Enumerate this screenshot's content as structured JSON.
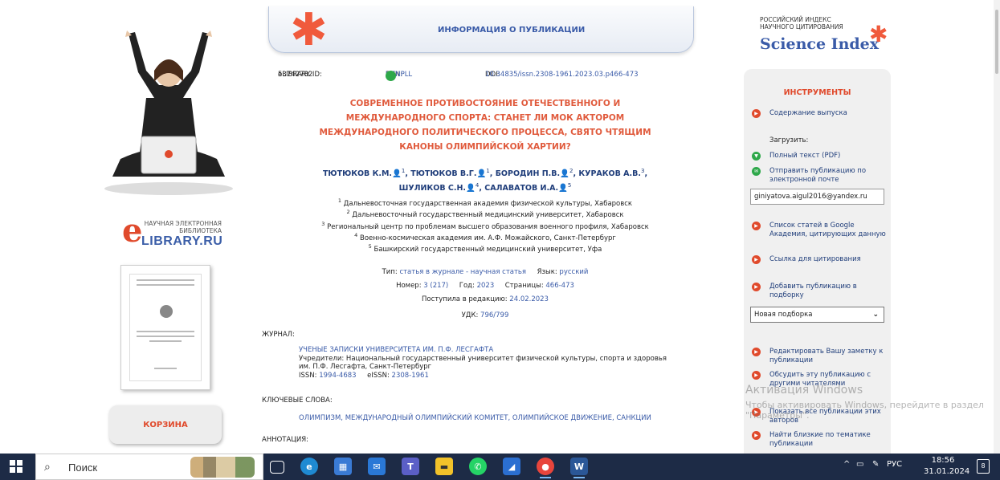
{
  "header": {
    "title": "ИНФОРМАЦИЯ О ПУБЛИКАЦИИ"
  },
  "science_index": {
    "line1": "РОССИЙСКИЙ ИНДЕКС",
    "line2": "НАУЧНОГО ЦИТИРОВАНИЯ",
    "name": "Science Index"
  },
  "elibrary": {
    "line1": "НАУЧНАЯ ЭЛЕКТРОННАЯ",
    "line2": "БИБЛИОТЕКА",
    "name": "LIBRARY.RU"
  },
  "ids": {
    "elibrary_label": "eLIBRARY ID:",
    "elibrary_id": "53742782",
    "edn_label": "EDN:",
    "edn": "HZNPLL",
    "doi_label": "DOI:",
    "doi": "10.34835/issn.2308-1961.2023.03.p466-473"
  },
  "article": {
    "title_lines": [
      "СОВРЕМЕННОЕ ПРОТИВОСТОЯНИЕ ОТЕЧЕСТВЕННОГО И",
      "МЕЖДУНАРОДНОГО СПОРТА: СТАНЕТ ЛИ МОК АКТОРОМ",
      "МЕЖДУНАРОДНОГО ПОЛИТИЧЕСКОГО ПРОЦЕССА, СВЯТО ЧТЯЩИМ",
      "КАНОНЫ ОЛИМПИЙСКОЙ ХАРТИИ?"
    ],
    "authors": [
      {
        "name": "ТЮТЮКОВ К.М.",
        "sup": "1"
      },
      {
        "name": "ТЮТЮКОВ В.Г.",
        "sup": "1"
      },
      {
        "name": "БОРОДИН П.В.",
        "sup": "2"
      },
      {
        "name": "КУРАКОВ А.В.",
        "sup": "3"
      },
      {
        "name": "ШУЛИКОВ С.Н.",
        "sup": "4"
      },
      {
        "name": "САЛАВАТОВ И.А.",
        "sup": "5"
      }
    ],
    "affiliations": [
      {
        "n": "1",
        "text": "Дальневосточная государственная академия физической культуры, Хабаровск"
      },
      {
        "n": "2",
        "text": "Дальневосточный государственный медицинский университет, Хабаровск"
      },
      {
        "n": "3",
        "text": "Региональный центр по проблемам высшего образования военного профиля, Хабаровск"
      },
      {
        "n": "4",
        "text": "Военно-космическая академия им. А.Ф. Можайского, Санкт-Петербург"
      },
      {
        "n": "5",
        "text": "Башкирский государственный медицинский университет, Уфа"
      }
    ],
    "type_label": "Тип:",
    "type": "статья в журнале - научная статья",
    "lang_label": "Язык:",
    "lang": "русский",
    "number_label": "Номер:",
    "number": "3 (217)",
    "year_label": "Год:",
    "year": "2023",
    "pages_label": "Страницы:",
    "pages": "466-473",
    "received_label": "Поступила в редакцию:",
    "received": "24.02.2023",
    "udk_label": "УДК:",
    "udk": "796/799"
  },
  "journal": {
    "section": "ЖУРНАЛ:",
    "name": "УЧЕНЫЕ ЗАПИСКИ УНИВЕРСИТЕТА ИМ. П.Ф. ЛЕСГАФТА",
    "founders": "Учредители: Национальный государственный университет физической культуры, спорта и здоровья",
    "founders2": "им. П.Ф. Лесгафта, Санкт-Петербург",
    "issn_label": "ISSN:",
    "issn": "1994-4683",
    "eissn_label": "eISSN:",
    "eissn": "2308-1961"
  },
  "keywords": {
    "section": "КЛЮЧЕВЫЕ СЛОВА:",
    "text": "ОЛИМПИЗМ, МЕЖДУНАРОДНЫЙ ОЛИМПИЙСКИЙ КОМИТЕТ, ОЛИМПИЙСКОЕ ДВИЖЕНИЕ, САНКЦИИ"
  },
  "annotation": {
    "section": "АННОТАЦИЯ:"
  },
  "cart": {
    "label": "КОРЗИНА"
  },
  "tools": {
    "title": "ИНСТРУМЕНТЫ",
    "contents": "Содержание выпуска",
    "download_label": "Загрузить:",
    "full_text": "Полный текст (PDF)",
    "send_email": "Отправить публикацию по электронной почте",
    "email_value": "giniyatova.aigul2016@yandex.ru",
    "google": "Список статей в Google Академия, цитирующих данную",
    "cite_link": "Ссылка для цитирования",
    "add_collection": "Добавить публикацию в подборку",
    "collection_select": "Новая подборка",
    "edit_note": "Редактировать Вашу заметку к публикации",
    "discuss": "Обсудить эту публикацию с другими читателями",
    "show_authors": "Показать все публикации этих авторов",
    "find_similar": "Найти близкие по тематике публикации"
  },
  "watermark": {
    "line1": "Активация Windows",
    "line2": "Чтобы активировать Windows, перейдите в раздел \"Параметры\"."
  },
  "taskbar": {
    "search_placeholder": "Поиск",
    "lang": "РУС",
    "time": "18:56",
    "date": "31.01.2024",
    "notifications": "8"
  },
  "colors": {
    "accent": "#e04a2c",
    "link": "#3a5ba8",
    "taskbar": "#1d2b46"
  }
}
